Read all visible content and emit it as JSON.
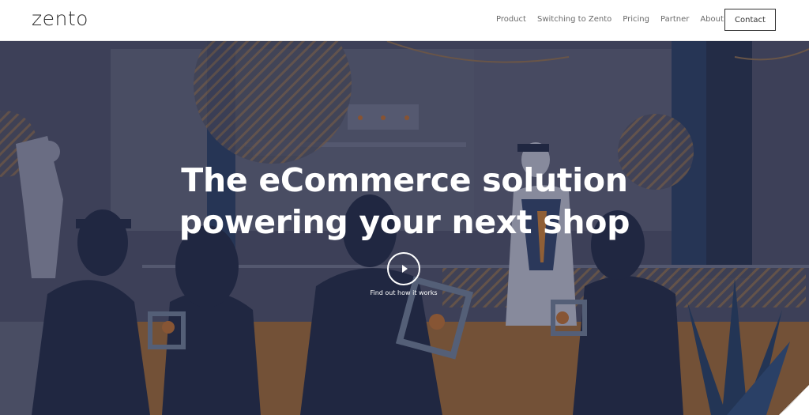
{
  "brand": {
    "logo_text": "zento"
  },
  "nav": {
    "links": [
      "Product",
      "Switching to Zento",
      "Pricing",
      "Partner",
      "About"
    ],
    "contact_label": "Contact"
  },
  "hero": {
    "title_line1": "The eCommerce solution",
    "title_line2": "powering your next shop",
    "play_label": "Find out how it works"
  },
  "colors": {
    "nav_bg": "#ffffff",
    "hero_overlay": "#3d4259",
    "navy": "#1b2440",
    "floor": "#a86a2c",
    "accent_orange": "#c77a2e",
    "text_white": "#ffffff"
  }
}
